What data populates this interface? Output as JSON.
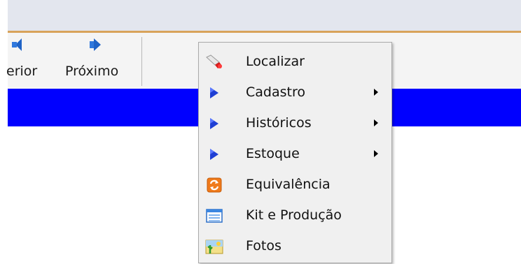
{
  "toolbar": {
    "prev_label": "erior",
    "next_label": "Próximo",
    "prev_icon": "arrow-left-icon",
    "next_icon": "arrow-right-icon"
  },
  "colors": {
    "band": "#0000ff",
    "titlebar": "#e3e6ee",
    "accent_line": "#d8a35a",
    "menu_bg": "#f0f0f0"
  },
  "menu": {
    "items": [
      {
        "label": "Localizar",
        "icon": "flashlight-icon",
        "submenu": false
      },
      {
        "label": "Cadastro",
        "icon": "play-arrow-icon",
        "submenu": true
      },
      {
        "label": "Históricos",
        "icon": "play-arrow-icon",
        "submenu": true
      },
      {
        "label": "Estoque",
        "icon": "play-arrow-icon",
        "submenu": true
      },
      {
        "label": "Equivalência",
        "icon": "refresh-icon",
        "submenu": false
      },
      {
        "label": "Kit e Produção",
        "icon": "list-window-icon",
        "submenu": false
      },
      {
        "label": "Fotos",
        "icon": "photo-icon",
        "submenu": false
      }
    ]
  }
}
